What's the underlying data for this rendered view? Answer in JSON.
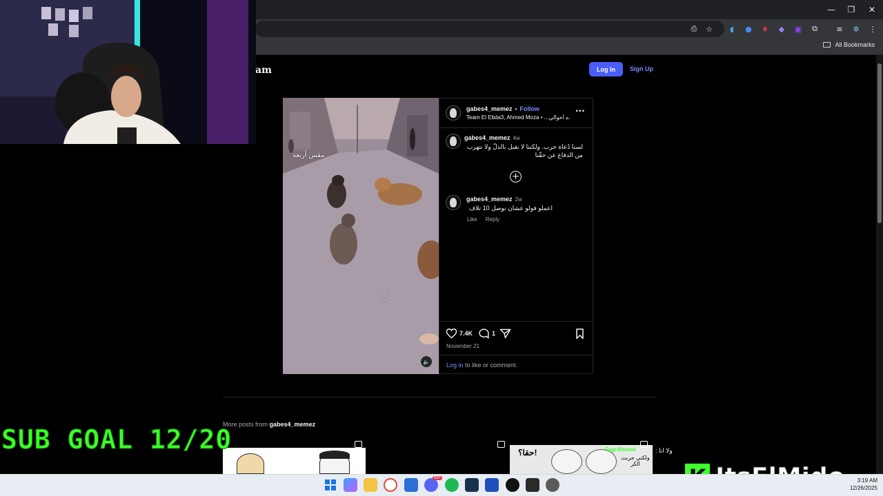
{
  "browser": {
    "bookmarks_label": "All Bookmarks",
    "window_controls": {
      "minimize": "—",
      "restore": "❐",
      "close": "✕"
    }
  },
  "header": {
    "logo_partial": "am",
    "login_label": "Log In",
    "signup_label": "Sign Up"
  },
  "post": {
    "username": "gabes4_memez",
    "separator": "•",
    "follow_label": "Follow",
    "audio_line": "Team El Ebda3, Ahmed Moza • ...ده أحوالي",
    "video_overlay_text": "مقس أربعة",
    "caption": {
      "username": "gabes4_memez",
      "age": "4w",
      "text": "لسنا دُعاة حرب. ولكننا لا نقبل بالذلّ ولا نتهرب من الدفاع عن حقّنا"
    },
    "comment": {
      "username": "gabes4_memez",
      "age": "2w",
      "text": "اعملو فولو عشان نوصل 10 تلاف",
      "like_label": "Like",
      "reply_label": "Reply"
    },
    "likes": "7.4K",
    "comments_count": "1",
    "date": "November 21",
    "login_prompt_link": "Log in",
    "login_prompt_rest": " to like or comment."
  },
  "more_posts": {
    "prefix": "More posts from ",
    "username": "gabes4_memez",
    "meme_text_1": "حقا؟!",
    "meme_text_2": "ولا انا :",
    "meme_text_3": "FagrAhmed",
    "meme_text_4": "ولكني جربت الكر"
  },
  "overlays": {
    "sub_goal": "SUB GOAL 12/20",
    "channel_letter": "K",
    "channel_name": "ItsElMido"
  },
  "taskbar": {
    "time": "3:19 AM",
    "date": "12/26/2025",
    "discord_badge": "99+"
  },
  "colors": {
    "accent_blue": "#4a5df9",
    "link_blue": "#7c8cff",
    "overlay_green": "#3dff2a"
  }
}
